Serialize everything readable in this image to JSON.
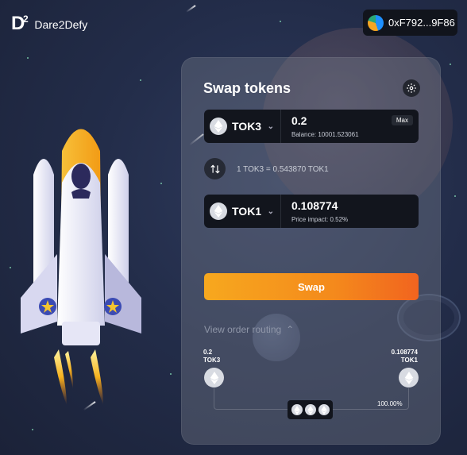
{
  "brand": {
    "logo_letter": "D",
    "logo_sup": "2",
    "name": "Dare2Defy"
  },
  "wallet": {
    "address": "0xF792...9F86"
  },
  "card": {
    "title": "Swap tokens",
    "from": {
      "symbol": "TOK3",
      "amount": "0.2",
      "balance": "Balance: 10001.523061",
      "max_label": "Max"
    },
    "rate": "1 TOK3 = 0.543870 TOK1",
    "to": {
      "symbol": "TOK1",
      "amount": "0.108774",
      "impact": "Price impact: 0.52%"
    },
    "swap_label": "Swap",
    "routing_label": "View order routing",
    "route": {
      "from_amount": "0.2",
      "from_symbol": "TOK3",
      "to_amount": "0.108774",
      "to_symbol": "TOK1",
      "percent": "100.00%"
    }
  },
  "icons": [
    "ethereum-icon",
    "gear-icon",
    "chevron-down-icon",
    "swap-arrows-icon",
    "chevron-up-icon"
  ],
  "colors": {
    "swap_start": "#f7a81e",
    "swap_end": "#f1641f",
    "background": "#232d4a"
  }
}
